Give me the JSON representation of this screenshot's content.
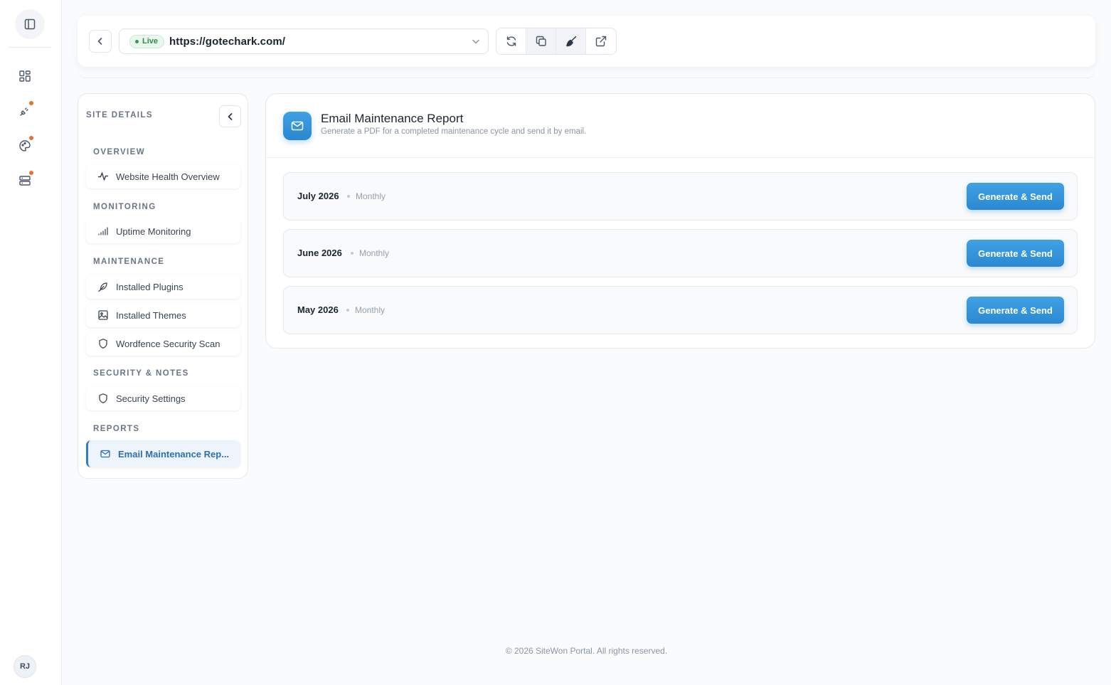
{
  "rail": {
    "avatar_initials": "RJ",
    "icons": [
      "sidebar-toggle-icon",
      "dashboard-grid-icon",
      "plug-icon",
      "palette-icon",
      "server-icon"
    ],
    "notification_color": "#e8702a"
  },
  "topbar": {
    "live_label": "Live",
    "url": "https://gotechark.com/"
  },
  "sidebar": {
    "title": "SITE DETAILS",
    "sections": {
      "overview": "OVERVIEW",
      "monitoring": "MONITORING",
      "maintenance": "MAINTENANCE",
      "security": "SECURITY & NOTES",
      "reports": "REPORTS"
    },
    "items": {
      "health": "Website Health Overview",
      "uptime": "Uptime Monitoring",
      "plugins": "Installed Plugins",
      "themes": "Installed Themes",
      "wordfence": "Wordfence Security Scan",
      "security_settings": "Security Settings",
      "email_report": "Email Maintenance Rep..."
    }
  },
  "card": {
    "title": "Email Maintenance Report",
    "subtitle": "Generate a PDF for a completed maintenance cycle and send it by email.",
    "rows": [
      {
        "month": "July 2026",
        "frequency": "Monthly",
        "button": "Generate & Send"
      },
      {
        "month": "June 2026",
        "frequency": "Monthly",
        "button": "Generate & Send"
      },
      {
        "month": "May 2026",
        "frequency": "Monthly",
        "button": "Generate & Send"
      }
    ]
  },
  "footer": "© 2026 SiteWon Portal. All rights reserved.",
  "colors": {
    "accent": "#2f7fc7",
    "button": "#3fa1e6",
    "live_green": "#2f8a4c"
  }
}
